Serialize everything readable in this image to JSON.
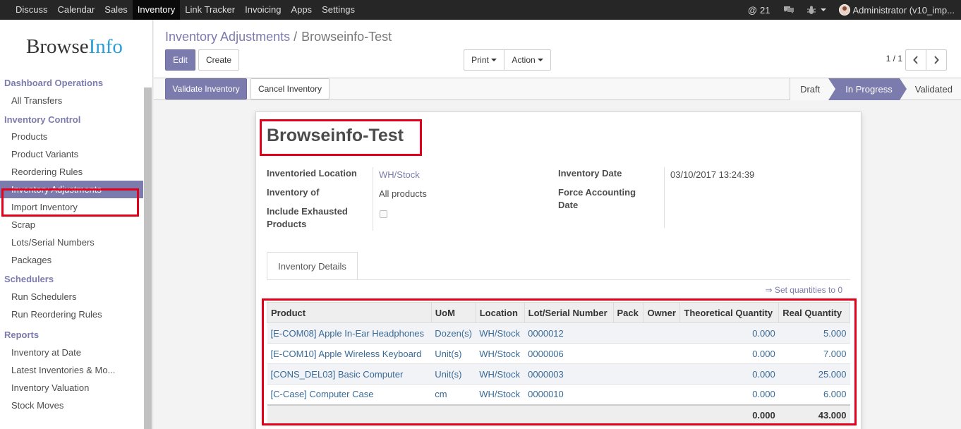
{
  "topbar": {
    "menu": [
      "Discuss",
      "Calendar",
      "Sales",
      "Inventory",
      "Link Tracker",
      "Invoicing",
      "Apps",
      "Settings"
    ],
    "active_menu": "Inventory",
    "mentions_count": "21",
    "user": "Administrator (v10_imp..."
  },
  "sidebar": {
    "logo_browse": "Browse",
    "logo_info": "Info",
    "sections": [
      {
        "title": "Dashboard Operations",
        "items": [
          "All Transfers"
        ]
      },
      {
        "title": "Inventory Control",
        "items": [
          "Products",
          "Product Variants",
          "Reordering Rules",
          "Inventory Adjustments",
          "Import Inventory",
          "Scrap",
          "Lots/Serial Numbers",
          "Packages"
        ]
      },
      {
        "title": "Schedulers",
        "items": [
          "Run Schedulers",
          "Run Reordering Rules"
        ]
      },
      {
        "title": "Reports",
        "items": [
          "Inventory at Date",
          "Latest Inventories & Mo...",
          "Inventory Valuation",
          "Stock Moves"
        ]
      }
    ],
    "active_item": "Inventory Adjustments"
  },
  "breadcrumb": {
    "parent": "Inventory Adjustments",
    "separator": "/",
    "current": "Browseinfo-Test"
  },
  "buttons": {
    "edit": "Edit",
    "create": "Create",
    "print": "Print",
    "action": "Action",
    "validate": "Validate Inventory",
    "cancel": "Cancel Inventory"
  },
  "pager": {
    "text": "1 / 1"
  },
  "status": {
    "steps": [
      "Draft",
      "In Progress",
      "Validated"
    ],
    "current": "In Progress"
  },
  "form": {
    "title": "Browseinfo-Test",
    "inventoried_location_label": "Inventoried Location",
    "inventoried_location": "WH/Stock",
    "inventory_of_label": "Inventory of",
    "inventory_of": "All products",
    "include_exhausted_label_1": "Include Exhausted",
    "include_exhausted_label_2": "Products",
    "include_exhausted": false,
    "inventory_date_label": "Inventory Date",
    "inventory_date": "03/10/2017 13:24:39",
    "force_accounting_label_1": "Force Accounting",
    "force_accounting_label_2": "Date"
  },
  "tabs": {
    "details": "Inventory Details"
  },
  "set_quantities": "⇒ Set quantities to 0",
  "table": {
    "columns": [
      "Product",
      "UoM",
      "Location",
      "Lot/Serial Number",
      "Pack",
      "Owner",
      "Theoretical Quantity",
      "Real Quantity"
    ],
    "rows": [
      {
        "product": "[E-COM08] Apple In-Ear Headphones",
        "uom": "Dozen(s)",
        "location": "WH/Stock",
        "lot": "0000012",
        "pack": "",
        "owner": "",
        "theoretical": "0.000",
        "real": "5.000"
      },
      {
        "product": "[E-COM10] Apple Wireless Keyboard",
        "uom": "Unit(s)",
        "location": "WH/Stock",
        "lot": "0000006",
        "pack": "",
        "owner": "",
        "theoretical": "0.000",
        "real": "7.000"
      },
      {
        "product": "[CONS_DEL03] Basic Computer",
        "uom": "Unit(s)",
        "location": "WH/Stock",
        "lot": "0000003",
        "pack": "",
        "owner": "",
        "theoretical": "0.000",
        "real": "25.000"
      },
      {
        "product": "[C-Case] Computer Case",
        "uom": "cm",
        "location": "WH/Stock",
        "lot": "0000010",
        "pack": "",
        "owner": "",
        "theoretical": "0.000",
        "real": "6.000"
      }
    ],
    "totals": {
      "theoretical": "0.000",
      "real": "43.000"
    }
  },
  "colors": {
    "accent": "#7c7bad",
    "highlight": "#e3001b",
    "topbar": "#262626"
  }
}
